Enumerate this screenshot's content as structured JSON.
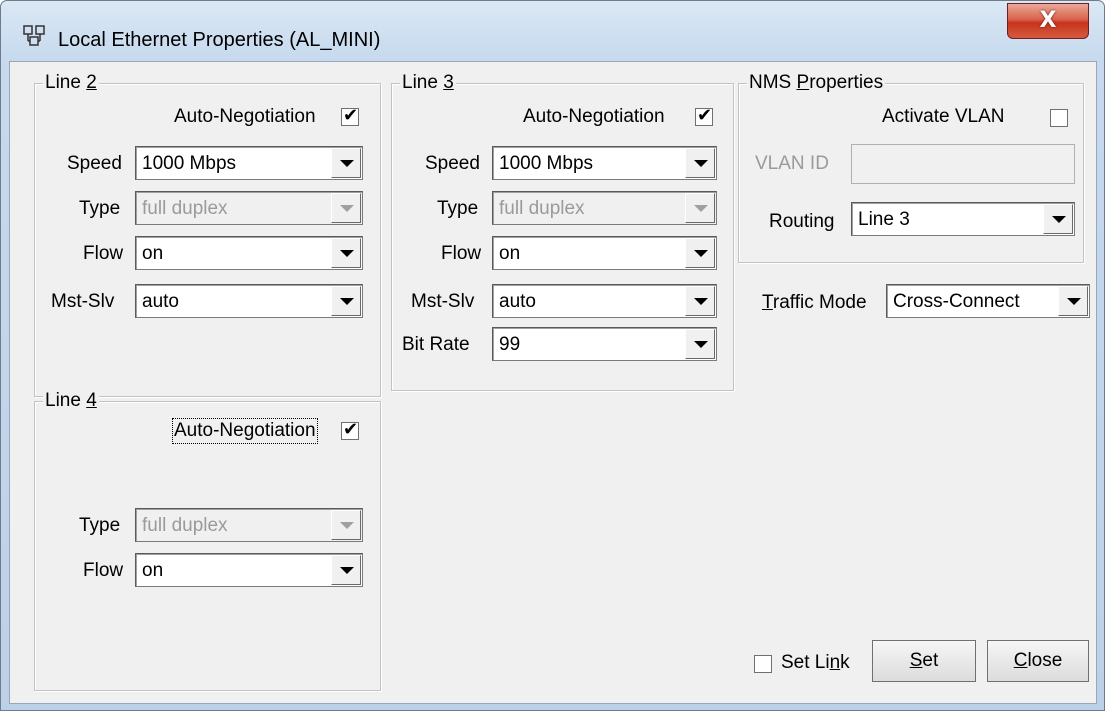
{
  "window": {
    "title": "Local Ethernet Properties (AL_MINI)",
    "close_glyph": "X",
    "app_icon": "network-properties-icon"
  },
  "line2": {
    "legend_pre": "Line ",
    "legend_key": "2",
    "auto_negotiation_label": "Auto-Negotiation",
    "auto_negotiation_checked": true,
    "speed_label": "Speed",
    "speed_value": "1000 Mbps",
    "type_label": "Type",
    "type_value": "full duplex",
    "flow_label": "Flow",
    "flow_value": "on",
    "mst_slv_label": "Mst-Slv",
    "mst_slv_value": "auto"
  },
  "line3": {
    "legend_pre": "Line ",
    "legend_key": "3",
    "auto_negotiation_label": "Auto-Negotiation",
    "auto_negotiation_checked": true,
    "speed_label": "Speed",
    "speed_value": "1000 Mbps",
    "type_label": "Type",
    "type_value": "full duplex",
    "flow_label": "Flow",
    "flow_value": "on",
    "mst_slv_label": "Mst-Slv",
    "mst_slv_value": "auto",
    "bit_rate_label": "Bit Rate",
    "bit_rate_value": "99"
  },
  "line4": {
    "legend_pre": "Line ",
    "legend_key": "4",
    "auto_negotiation_label": "Auto-Negotiation",
    "auto_negotiation_checked": true,
    "type_label": "Type",
    "type_value": "full duplex",
    "flow_label": "Flow",
    "flow_value": "on"
  },
  "nms": {
    "legend_pre": "NMS ",
    "legend_key": "P",
    "legend_post": "roperties",
    "activate_vlan_label": "Activate VLAN",
    "activate_vlan_checked": false,
    "vlan_id_label": "VLAN ID",
    "vlan_id_value": "",
    "routing_label": "Routing",
    "routing_value": "Line 3"
  },
  "traffic": {
    "label_key": "T",
    "label_rest": "raffic Mode",
    "value": "Cross-Connect"
  },
  "footer": {
    "set_link_pre": "Set Li",
    "set_link_key": "n",
    "set_link_post": "k",
    "set_link_checked": false,
    "set_key": "S",
    "set_rest": "et",
    "close_key": "C",
    "close_rest": "lose"
  }
}
